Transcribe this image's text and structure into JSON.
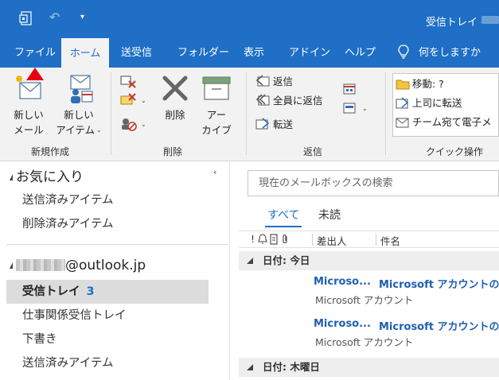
{
  "titlebar": {
    "window_title": "受信トレイ -",
    "undo_icon": "undo-icon",
    "app_icon": "outlook-quick-access-icon"
  },
  "tabs": [
    {
      "label": "ファイル"
    },
    {
      "label": "ホーム"
    },
    {
      "label": "送受信"
    },
    {
      "label": "フォルダー"
    },
    {
      "label": "表示"
    },
    {
      "label": "アドイン"
    },
    {
      "label": "ヘルプ"
    },
    {
      "label": "何をしますか"
    }
  ],
  "ribbon": {
    "new_group": {
      "new_mail_line1": "新しい",
      "new_mail_line2": "メール",
      "new_items_line1": "新しい",
      "new_items_line2": "アイテム",
      "label": "新規作成"
    },
    "delete_group": {
      "delete_label": "削除",
      "archive_line1": "アー",
      "archive_line2": "カイブ",
      "label": "削除"
    },
    "respond_group": {
      "reply": "返信",
      "reply_all": "全員に返信",
      "forward": "転送",
      "label": "返信"
    },
    "quick_steps": {
      "move": "移動: ?",
      "to_manager": "上司に転送",
      "team_email": "チーム宛て電子メ",
      "label": "クイック操作"
    }
  },
  "folders": {
    "favorites_header": "お気に入り",
    "favorites": [
      {
        "label": "送信済みアイテム"
      },
      {
        "label": "削除済みアイテム"
      }
    ],
    "account_suffix": "@outlook.jp",
    "account_items": [
      {
        "label": "受信トレイ",
        "count": "3"
      },
      {
        "label": "仕事関係受信トレイ"
      },
      {
        "label": "下書き"
      },
      {
        "label": "送信済みアイテム"
      }
    ]
  },
  "messages": {
    "search_placeholder": "現在のメールボックスの検索",
    "filter_all": "すべて",
    "filter_unread": "未読",
    "columns": {
      "flags": "!",
      "sender": "差出人",
      "subject": "件名"
    },
    "groups": [
      {
        "label": "日付: 今日",
        "items": [
          {
            "sender": "Microso...",
            "subject": "Microsoft アカウントの",
            "preview": "Microsoft アカウント"
          },
          {
            "sender": "Microso...",
            "subject": "Microsoft アカウントの",
            "preview": "Microsoft アカウント"
          }
        ]
      },
      {
        "label": "日付: 木曜日",
        "items": []
      }
    ]
  },
  "colors": {
    "accent": "#1e6fc5",
    "ribbon_bg": "#f2f2f2",
    "selected_folder": "#dcdcdc",
    "annotation_arrow": "#e60012"
  }
}
